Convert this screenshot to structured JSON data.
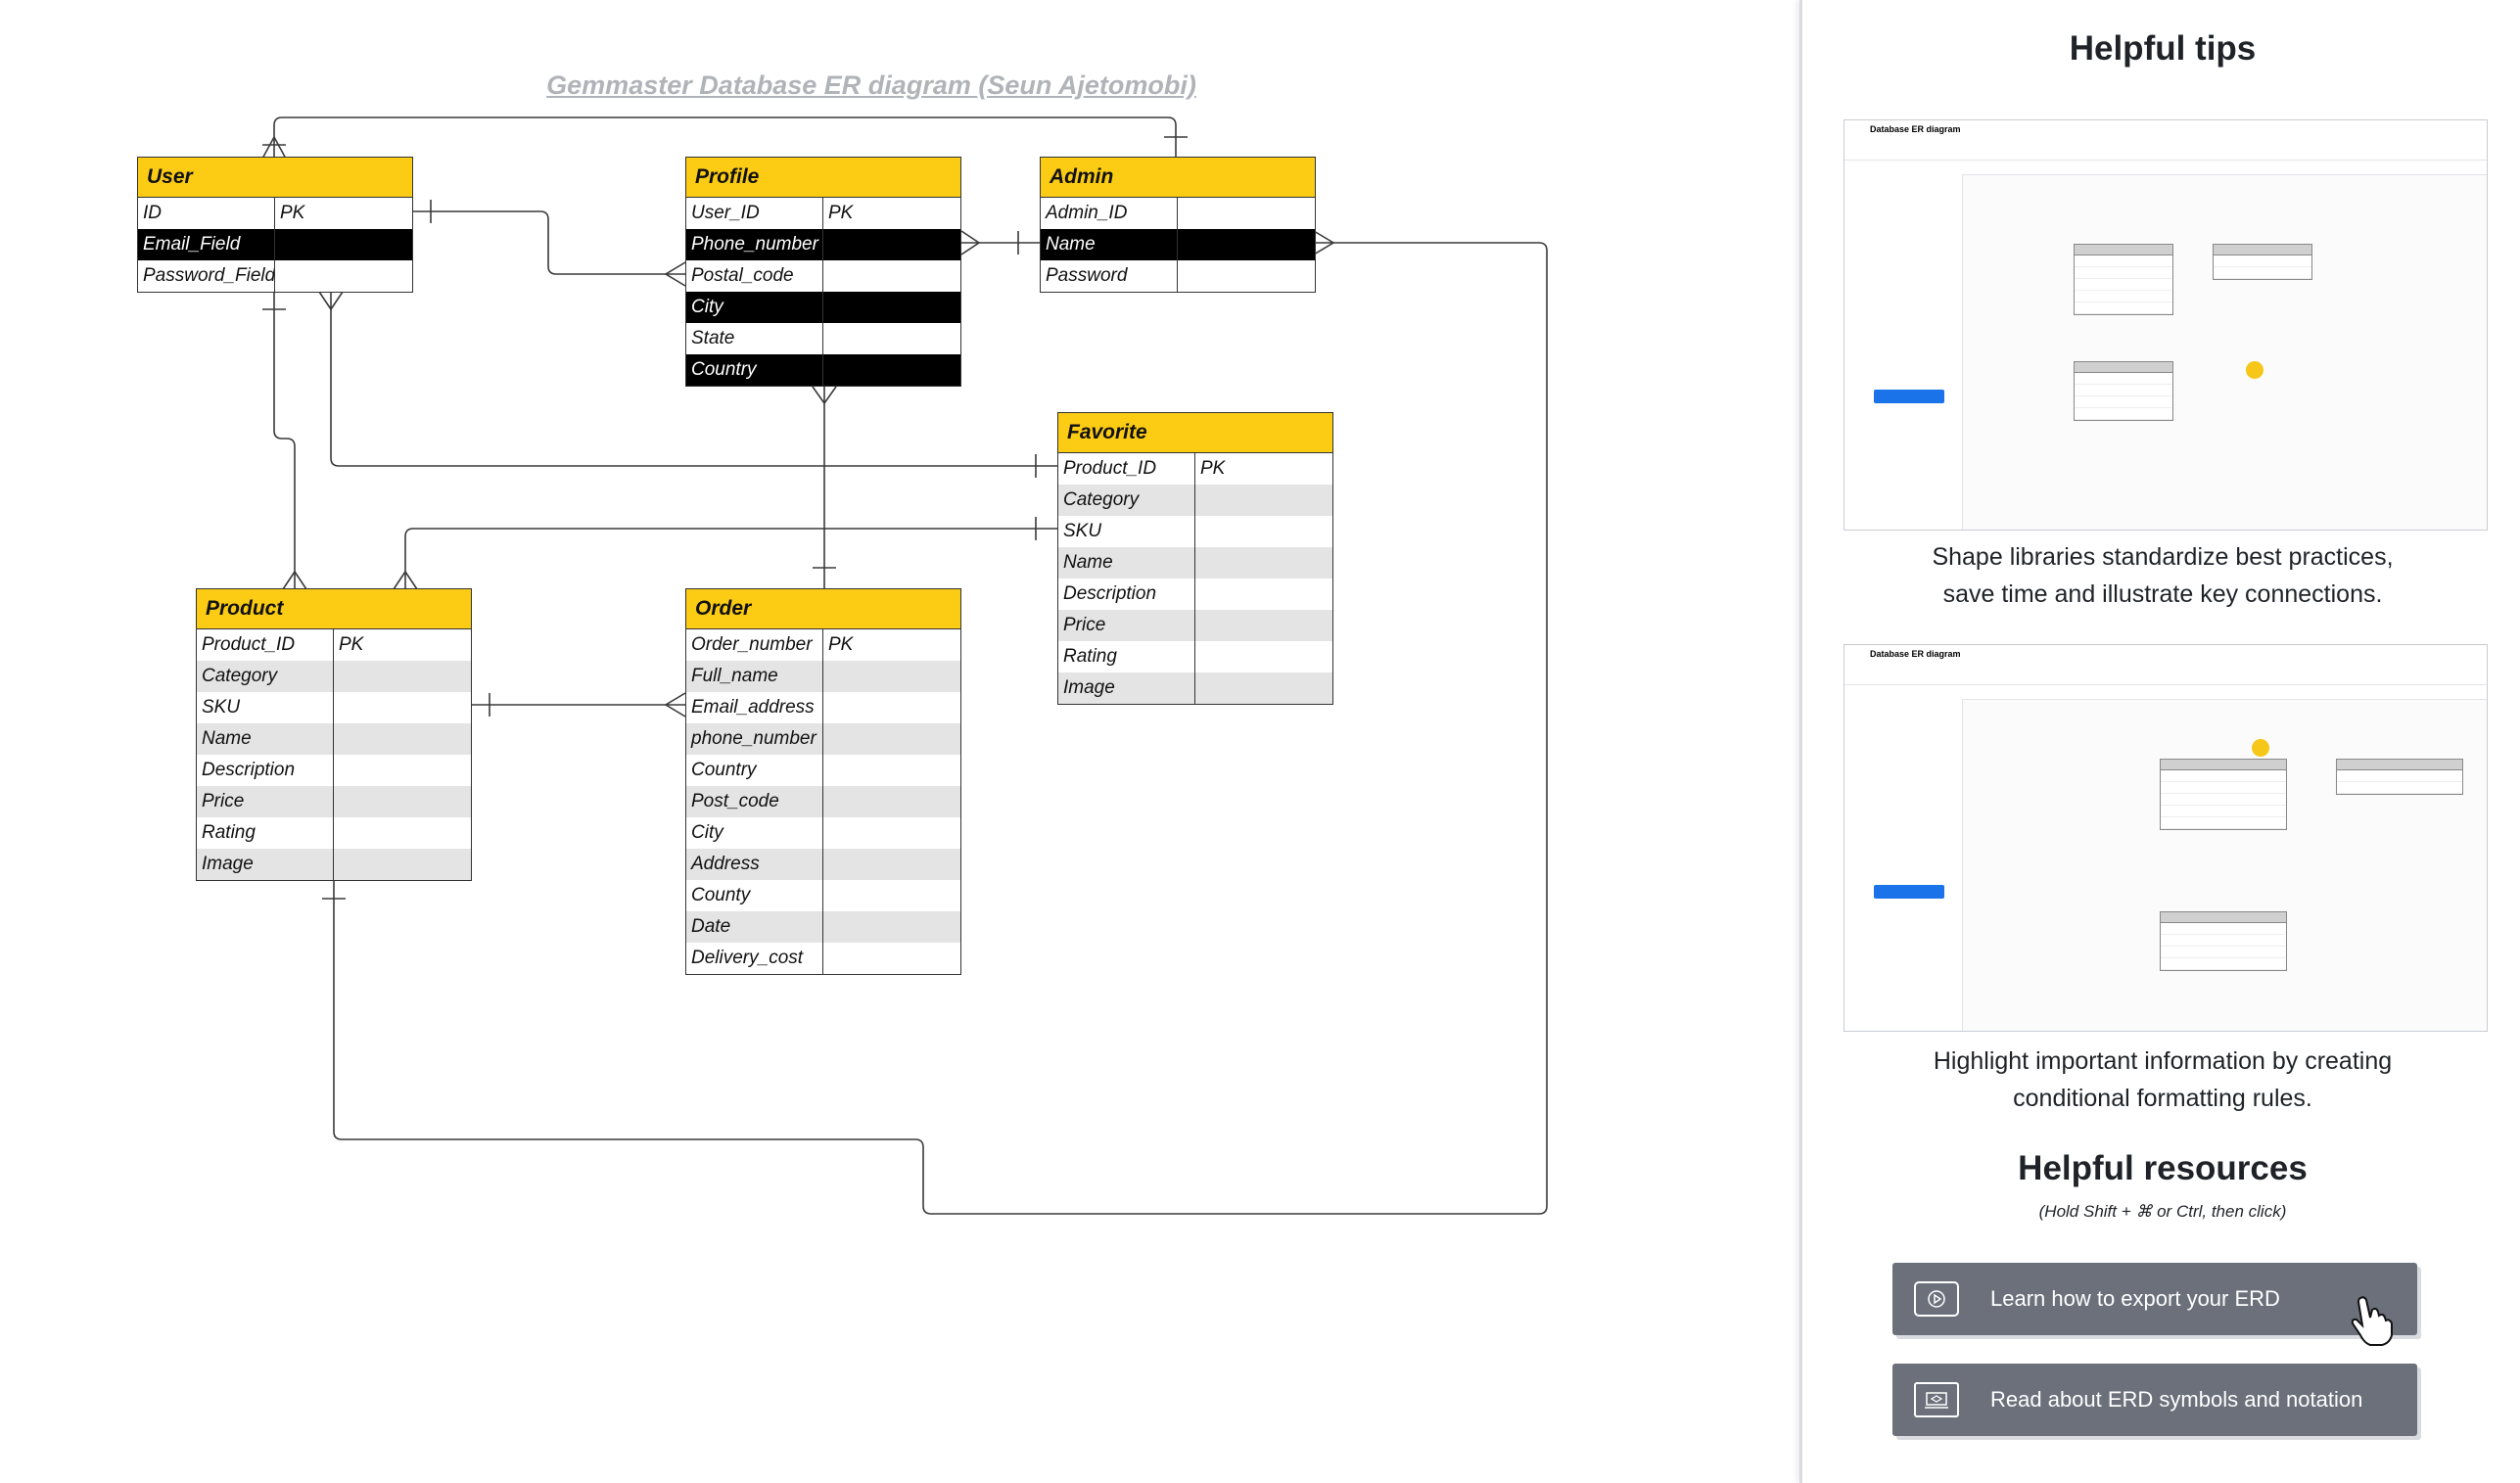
{
  "diagram": {
    "title": "Gemmaster Database ER diagram (Seun Ajetomobi)",
    "entities": {
      "user": {
        "name": "User",
        "rows": [
          [
            "ID",
            "PK"
          ],
          [
            "Email_Field",
            ""
          ],
          [
            "Password_Field",
            ""
          ]
        ]
      },
      "profile": {
        "name": "Profile",
        "rows": [
          [
            "User_ID",
            "PK"
          ],
          [
            "Phone_number",
            ""
          ],
          [
            "Postal_code",
            ""
          ],
          [
            "City",
            ""
          ],
          [
            "State",
            ""
          ],
          [
            "Country",
            ""
          ]
        ]
      },
      "admin": {
        "name": "Admin",
        "rows": [
          [
            "Admin_ID",
            ""
          ],
          [
            "Name",
            ""
          ],
          [
            "Password",
            ""
          ]
        ]
      },
      "favorite": {
        "name": "Favorite",
        "rows": [
          [
            "Product_ID",
            "PK"
          ],
          [
            "Category",
            ""
          ],
          [
            "SKU",
            ""
          ],
          [
            "Name",
            ""
          ],
          [
            "Description",
            ""
          ],
          [
            "Price",
            ""
          ],
          [
            "Rating",
            ""
          ],
          [
            "Image",
            ""
          ]
        ]
      },
      "product": {
        "name": "Product",
        "rows": [
          [
            "Product_ID",
            "PK"
          ],
          [
            "Category",
            ""
          ],
          [
            "SKU",
            ""
          ],
          [
            "Name",
            ""
          ],
          [
            "Description",
            ""
          ],
          [
            "Price",
            ""
          ],
          [
            "Rating",
            ""
          ],
          [
            "Image",
            ""
          ]
        ]
      },
      "order": {
        "name": "Order",
        "rows": [
          [
            "Order_number",
            "PK"
          ],
          [
            "Full_name",
            ""
          ],
          [
            "Email_address",
            ""
          ],
          [
            "phone_number",
            ""
          ],
          [
            "Country",
            ""
          ],
          [
            "Post_code",
            ""
          ],
          [
            "City",
            ""
          ],
          [
            "Address",
            ""
          ],
          [
            "County",
            ""
          ],
          [
            "Date",
            ""
          ],
          [
            "Delivery_cost",
            ""
          ]
        ]
      }
    },
    "header_color": "#fccc14",
    "highlight_color": "#000000",
    "stripe_color": "#e4e4e4"
  },
  "panel": {
    "tips_heading": "Helpful tips",
    "tip1_caption_line1": "Shape libraries standardize best practices,",
    "tip1_caption_line2": "save time and illustrate key connections.",
    "tip2_caption_line1": "Highlight important information by creating",
    "tip2_caption_line2": "conditional formatting rules.",
    "resources_heading": "Helpful resources",
    "resources_hint": "(Hold Shift + ⌘ or Ctrl, then click)",
    "resource1": {
      "label": "Learn how to export your ERD",
      "icon": "play-video-icon"
    },
    "resource2": {
      "label": "Read about ERD symbols and notation",
      "icon": "laptop-course-icon"
    },
    "accent_color": "#fbd58e",
    "button_color": "#6b707b",
    "screenshot_doc_title": "Database ER diagram"
  }
}
